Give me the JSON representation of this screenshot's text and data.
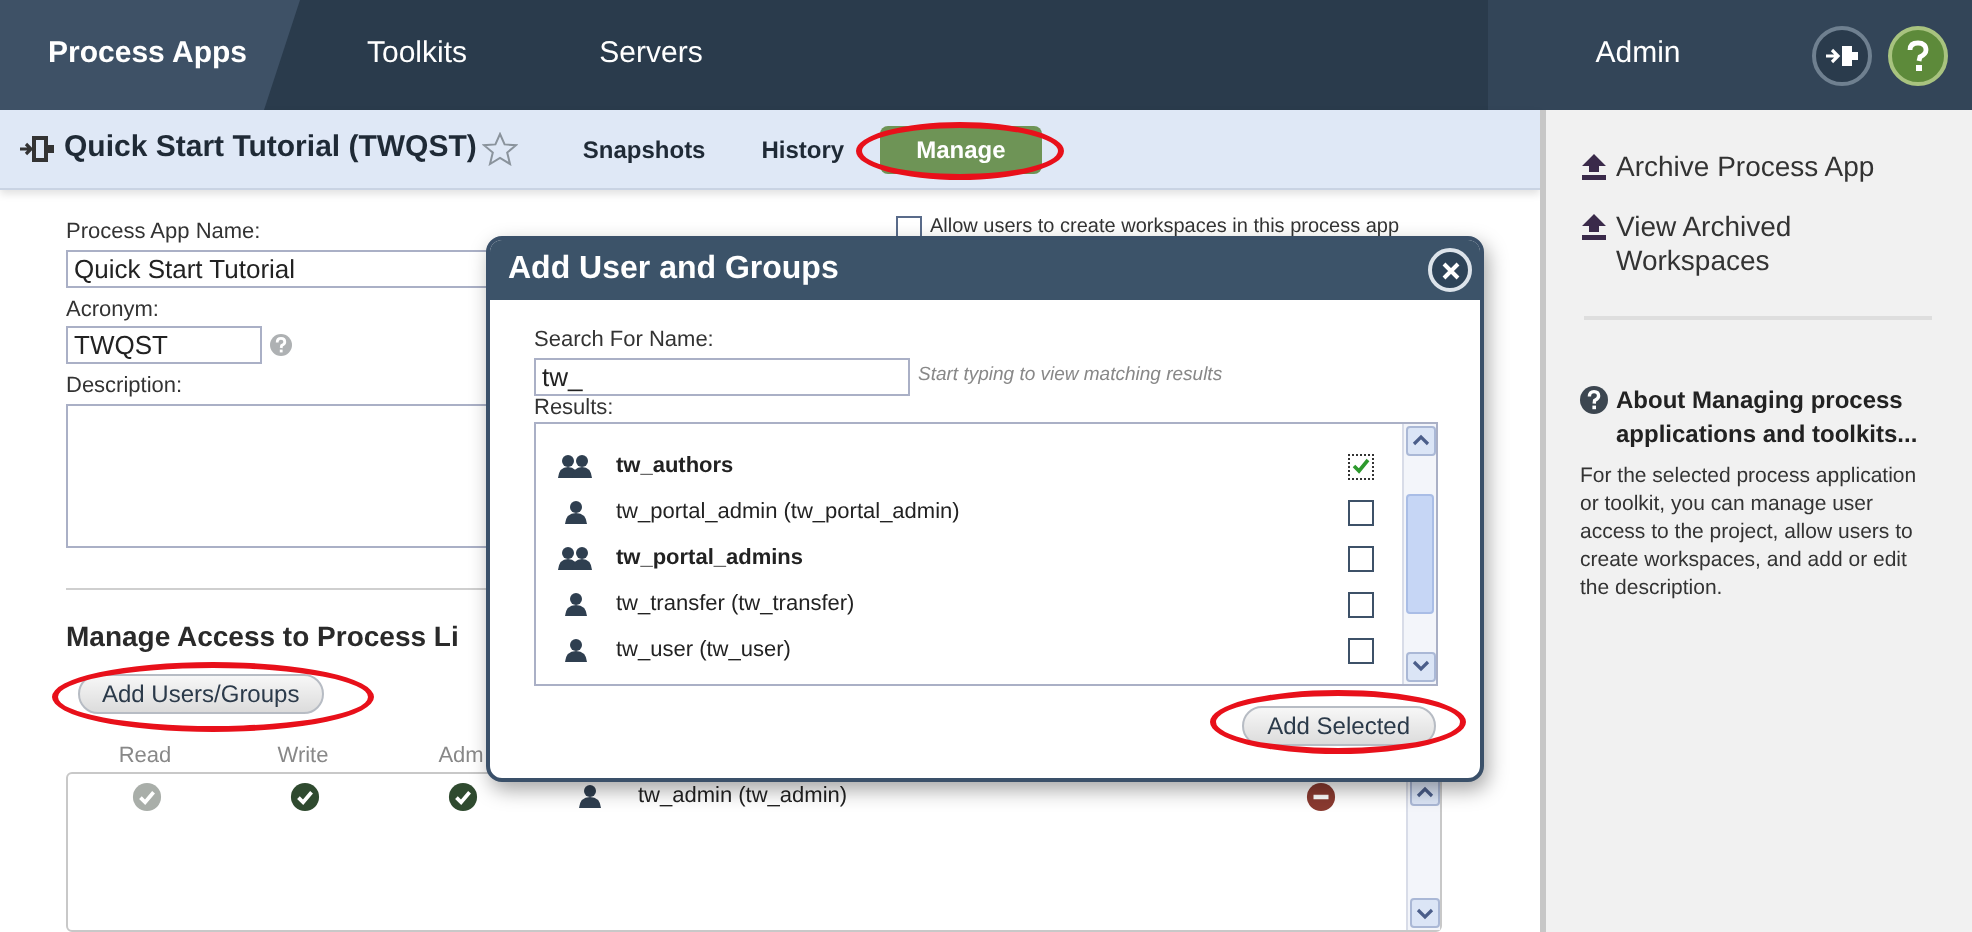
{
  "top_nav": {
    "tabs": [
      {
        "label": "Process Apps",
        "selected": true
      },
      {
        "label": "Toolkits",
        "selected": false
      },
      {
        "label": "Servers",
        "selected": false
      }
    ],
    "admin": "Admin"
  },
  "subheader": {
    "title": "Quick Start Tutorial (TWQST)",
    "starred": false,
    "tabs": [
      {
        "label": "Snapshots",
        "selected": false
      },
      {
        "label": "History",
        "selected": false
      },
      {
        "label": "Manage",
        "selected": true
      }
    ]
  },
  "form": {
    "name_label": "Process App Name:",
    "name_value": "Quick Start Tutorial",
    "acronym_label": "Acronym:",
    "acronym_value": "TWQST",
    "description_label": "Description:",
    "allow_workspaces": {
      "label": "Allow users to create workspaces in this process app",
      "checked": false
    }
  },
  "access": {
    "heading": "Manage Access to Process Li",
    "add_button": "Add Users/Groups",
    "columns": [
      "Read",
      "Write",
      "Adm"
    ],
    "rows": [
      {
        "read": false,
        "write": true,
        "admin": true,
        "name": "tw_admin (tw_admin)"
      }
    ]
  },
  "dialog": {
    "title": "Add User and Groups",
    "search_label": "Search For Name:",
    "search_value": "tw_",
    "hint": "Start typing to view matching results",
    "results_label": "Results:",
    "results": [
      {
        "kind": "group",
        "name": "tw_authors",
        "checked": true
      },
      {
        "kind": "user",
        "name": "tw_portal_admin (tw_portal_admin)",
        "checked": false
      },
      {
        "kind": "group",
        "name": "tw_portal_admins",
        "checked": false
      },
      {
        "kind": "user",
        "name": "tw_transfer (tw_transfer)",
        "checked": false
      },
      {
        "kind": "user",
        "name": "tw_user (tw_user)",
        "checked": false
      }
    ],
    "add_button": "Add Selected"
  },
  "sidebar": {
    "links": [
      "Archive Process App",
      "View Archived Workspaces"
    ],
    "help_title": "About Managing process applications and toolkits...",
    "help_text": "For the selected process application or toolkit, you can manage user access to the project, allow users to create workspaces, and add or edit the description."
  }
}
